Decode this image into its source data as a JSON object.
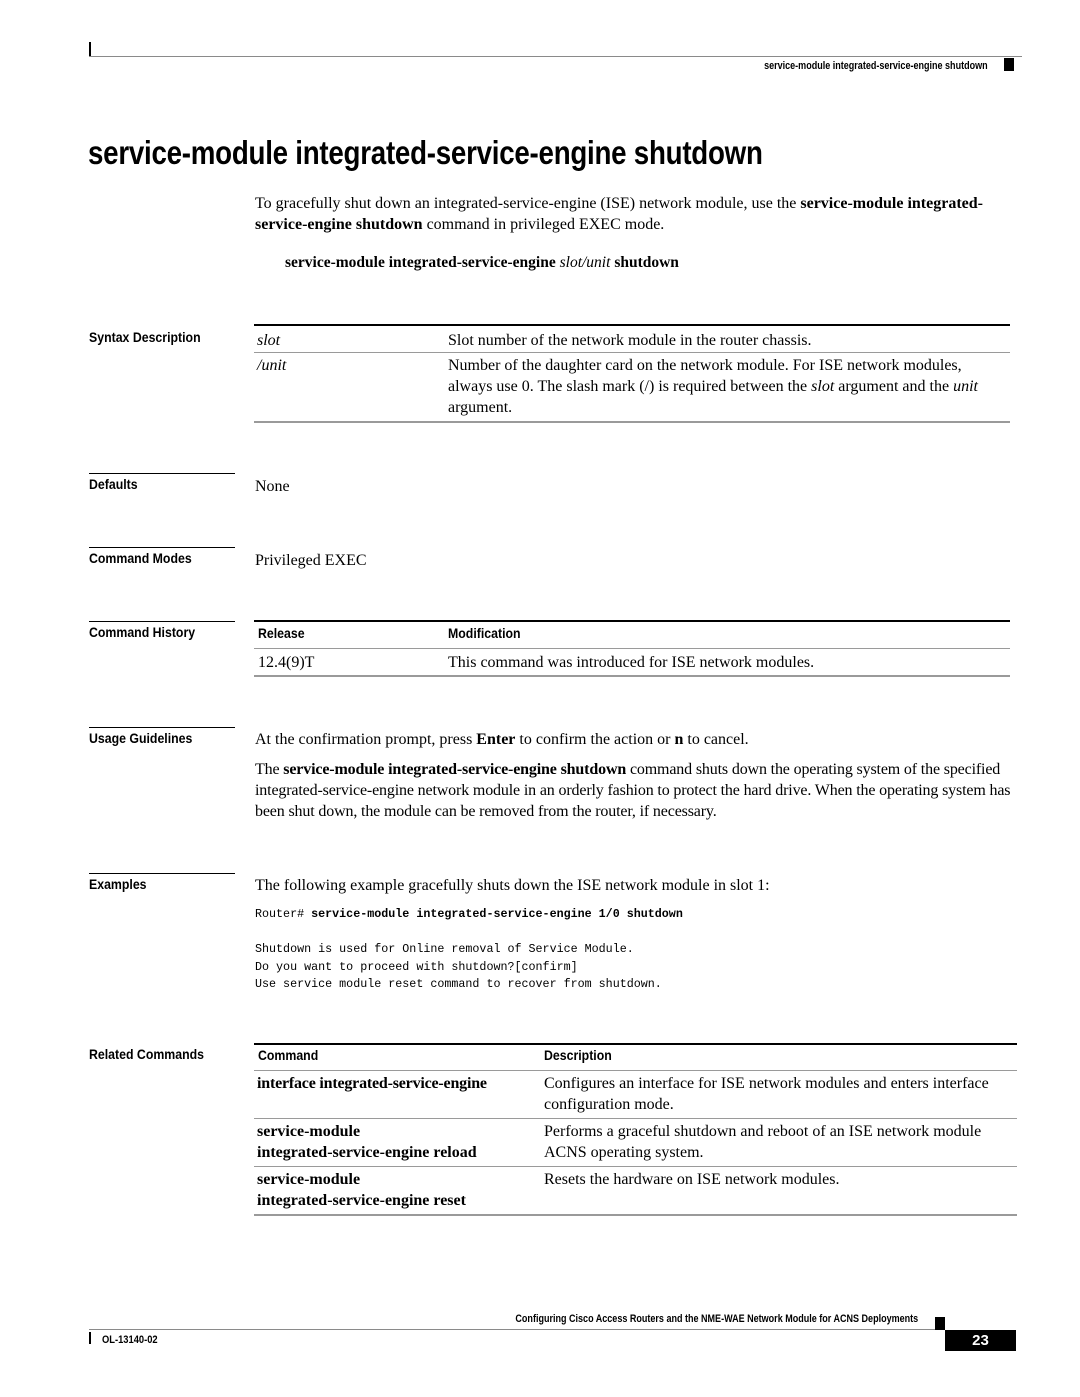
{
  "header": {
    "running_title": "service-module integrated-service-engine shutdown"
  },
  "title": "service-module integrated-service-engine shutdown",
  "intro": {
    "part1": "To gracefully shut down an integrated-service-engine (ISE) network module, use the ",
    "bold": "service-module integrated-service-engine shutdown",
    "part2": " command in privileged EXEC mode."
  },
  "syntax_line": {
    "cmd": "service-module integrated-service-engine ",
    "arg": "slot/unit",
    "suffix": " shutdown"
  },
  "sections": {
    "syntax_description": "Syntax Description",
    "defaults": "Defaults",
    "command_modes": "Command Modes",
    "command_history": "Command History",
    "usage_guidelines": "Usage Guidelines",
    "examples": "Examples",
    "related_commands": "Related Commands"
  },
  "syntax_description": {
    "rows": [
      {
        "arg": "slot",
        "desc": "Slot number of the network module in the router chassis."
      },
      {
        "arg": "/unit",
        "desc_a": "Number of the daughter card on the network module. For ISE network modules, always use 0. The slash mark (/) is required between the ",
        "desc_i1": "slot",
        "desc_b": " argument and the ",
        "desc_i2": "unit",
        "desc_c": " argument."
      }
    ]
  },
  "defaults": "None",
  "command_modes": "Privileged EXEC",
  "command_history": {
    "headers": [
      "Release",
      "Modification"
    ],
    "rows": [
      {
        "release": "12.4(9)T",
        "modification": "This command was introduced for ISE network modules."
      }
    ]
  },
  "usage_guidelines": {
    "p1_a": "At the confirmation prompt, press ",
    "p1_b1": "Enter",
    "p1_c": " to confirm the action or ",
    "p1_b2": "n",
    "p1_d": " to cancel.",
    "p2_a": "The ",
    "p2_bold": "service-module integrated-service-engine shutdown",
    "p2_b": " command shuts down the operating system of the specified integrated-service-engine network module in an orderly fashion to protect the hard drive. When the operating system has been shut down, the module can be removed from the router, if necessary."
  },
  "examples": {
    "intro": "The following example gracefully shuts down the ISE network module in slot 1:",
    "prompt": "Router# ",
    "command": "service-module integrated-service-engine 1/0 shutdown",
    "output": [
      "Shutdown is used for Online removal of Service Module.",
      "Do you want to proceed with shutdown?[confirm]",
      "Use service module reset command to recover from shutdown."
    ]
  },
  "related_commands": {
    "headers": [
      "Command",
      "Description"
    ],
    "rows": [
      {
        "command_l1": "interface integrated-service-engine",
        "command_l2": "",
        "description": "Configures an interface for ISE network modules and enters interface configuration mode."
      },
      {
        "command_l1": "service-module",
        "command_l2": "integrated-service-engine reload",
        "description": "Performs a graceful shutdown and reboot of an ISE network module ACNS operating system."
      },
      {
        "command_l1": "service-module",
        "command_l2": "integrated-service-engine reset",
        "description": "Resets the hardware on ISE network modules."
      }
    ]
  },
  "footer": {
    "book_title": "Configuring Cisco Access Routers and the NME-WAE Network Module for ACNS Deployments",
    "doc_number": "OL-13140-02",
    "page_number": "23"
  }
}
